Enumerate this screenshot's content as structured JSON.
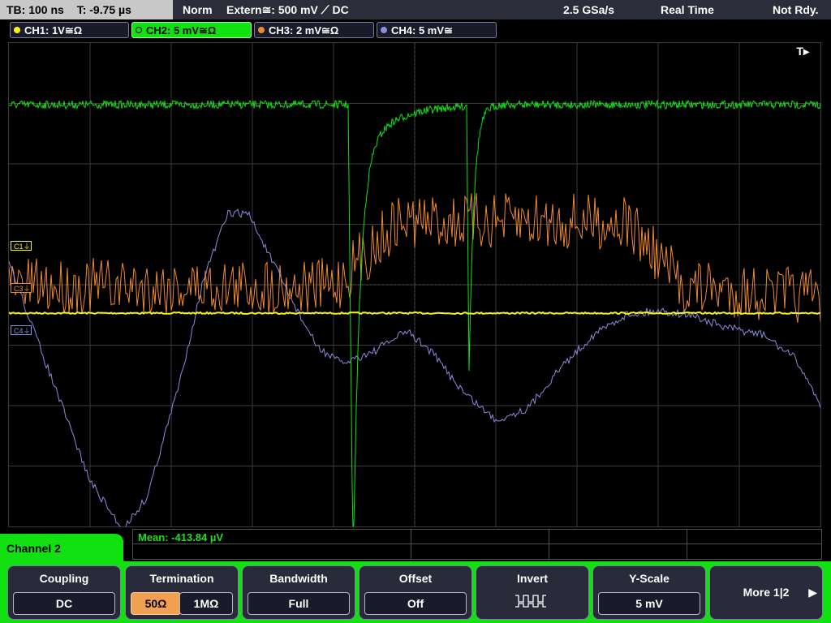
{
  "topbar": {
    "timebase": "TB: 100 ns",
    "trigger_time": "T: -9.75 µs",
    "mode": "Norm",
    "trigger_source": "Extern≅: 500 mV ⟋ DC",
    "sample_rate": "2.5 GSa/s",
    "acq_mode": "Real Time",
    "status": "Not Rdy."
  },
  "channels": [
    {
      "label": "CH1: 1V≅Ω",
      "color": "#f5f514"
    },
    {
      "label": "CH2: 5 mV≅Ω",
      "color": "#11e011"
    },
    {
      "label": "CH3: 2 mV≅Ω",
      "color": "#f08a30"
    },
    {
      "label": "CH4: 5 mV≅",
      "color": "#8c8ce0"
    }
  ],
  "markers": {
    "c1": "C1",
    "c3": "C3",
    "c4": "C4",
    "trigger": "T"
  },
  "measurement": {
    "mean": "Mean: -413.84 µV"
  },
  "channel_tab": "Channel 2",
  "softkeys": {
    "coupling": {
      "label": "Coupling",
      "value": "DC"
    },
    "termination": {
      "label": "Termination",
      "value_a": "50Ω",
      "value_b": "1MΩ"
    },
    "bandwidth": {
      "label": "Bandwidth",
      "value": "Full"
    },
    "offset": {
      "label": "Offset",
      "value": "Off"
    },
    "invert": {
      "label": "Invert"
    },
    "yscale": {
      "label": "Y-Scale",
      "value": "5 mV"
    },
    "more": {
      "label": "More 1|2"
    }
  }
}
